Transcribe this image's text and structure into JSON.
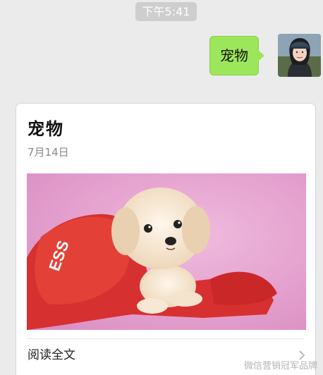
{
  "chat": {
    "timestamp": "下午5:41",
    "outgoing_message": "宠物"
  },
  "article_card": {
    "title": "宠物",
    "date": "7月14日",
    "read_more_label": "阅读全文",
    "image_desc_icon": "puppy-photo"
  },
  "watermark": "微信营销冠军品牌",
  "colors": {
    "background": "#ebebeb",
    "bubble_green": "#9ce65b",
    "card_bg": "#ffffff",
    "timestamp_bg": "#cecece"
  }
}
